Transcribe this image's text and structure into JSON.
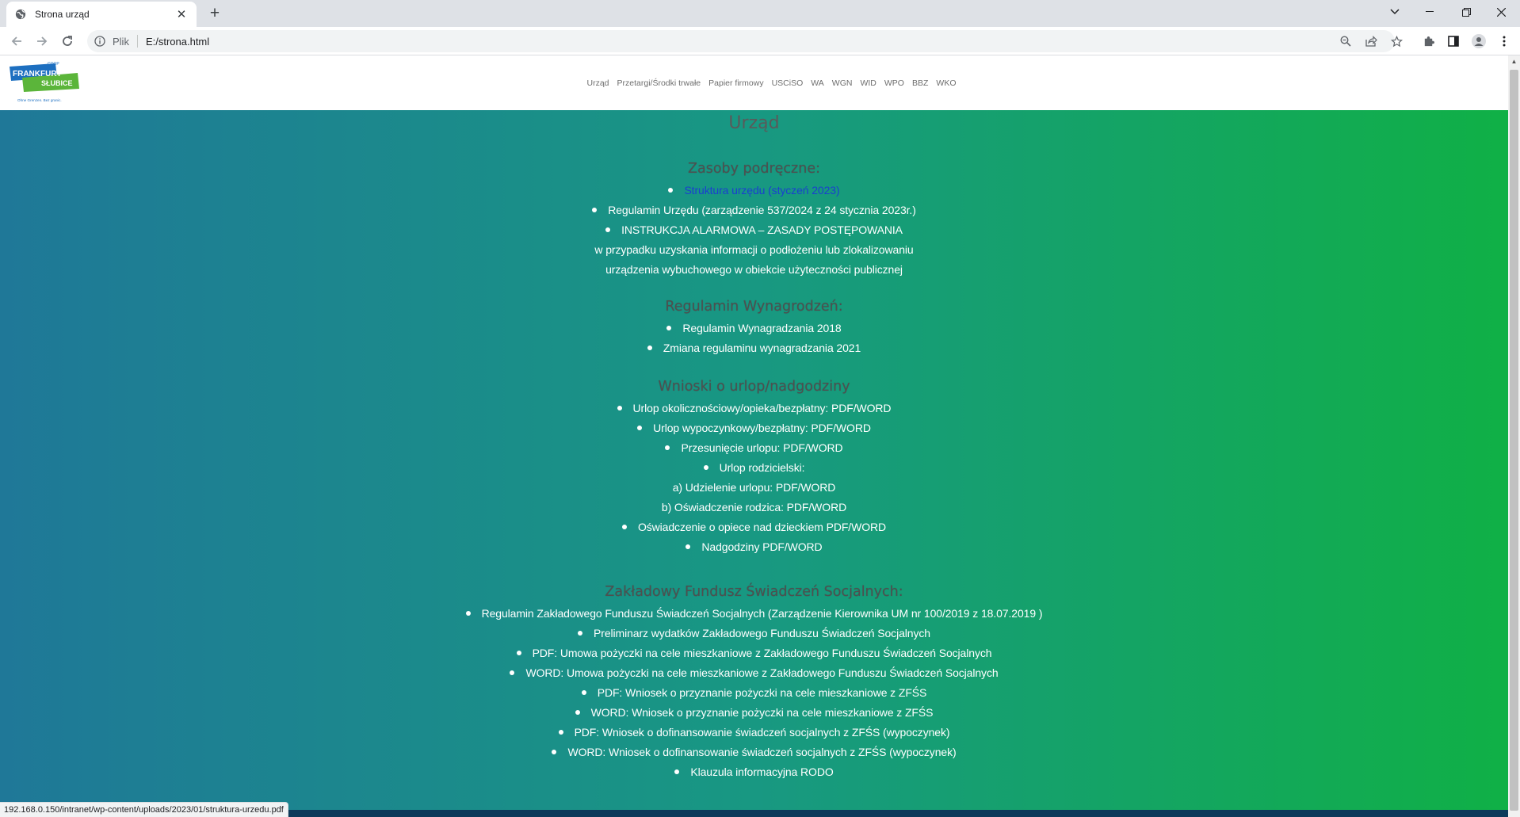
{
  "browser": {
    "tab": {
      "title": "Strona urząd",
      "favicon": "globe-icon"
    },
    "new_tab": "+",
    "address": {
      "scheme": "Plik",
      "url": "E:/strona.html"
    },
    "status_url": "192.168.0.150/intranet/wp-content/uploads/2023/01/struktura-urzedu.pdf"
  },
  "site": {
    "logo": {
      "top_small": "COOP",
      "line1": "FRANKFURT",
      "line2": "SŁUBICE",
      "tagline": "Ohne Grenzen. Bez granic."
    },
    "nav": [
      "Urząd",
      "Przetargi/Środki trwałe",
      "Papier firmowy",
      "USCiSO",
      "WA",
      "WGN",
      "WID",
      "WPO",
      "BBZ",
      "WKO"
    ]
  },
  "page": {
    "heading": "Urząd",
    "sections": {
      "zasoby": {
        "heading": "Zasoby podręczne:",
        "items": [
          "Struktura urzędu (styczeń 2023)",
          "Regulamin Urzędu (zarządzenie 537/2024 z 24 stycznia 2023r.)",
          "INSTRUKCJA ALARMOWA – ZASADY POSTĘPOWANIA",
          "w przypadku uzyskania informacji o podłożeniu lub zlokalizowaniu",
          "urządzenia wybuchowego w obiekcie użyteczności publicznej"
        ]
      },
      "regulamin": {
        "heading": "Regulamin Wynagrodzeń:",
        "items": [
          "Regulamin Wynagradzania 2018",
          "Zmiana regulaminu wynagradzania 2021"
        ]
      },
      "wnioski": {
        "heading": "Wnioski o urlop/nadgodziny",
        "items": [
          "Urlop okolicznościowy/opieka/bezpłatny: PDF/WORD",
          "Urlop wypoczynkowy/bezpłatny: PDF/WORD",
          "Przesunięcie urlopu: PDF/WORD",
          "Urlop rodzicielski:",
          "a) Udzielenie urlopu: PDF/WORD",
          "b) Oświadczenie rodzica: PDF/WORD",
          "Oświadczenie o opiece nad dzieckiem PDF/WORD",
          "Nadgodziny PDF/WORD"
        ]
      },
      "fundusz": {
        "heading": "Zakładowy Fundusz Świadczeń Socjalnych:",
        "items": [
          "Regulamin Zakładowego Funduszu Świadczeń Socjalnych (Zarządzenie Kierownika UM nr 100/2019 z 18.07.2019 )",
          "Preliminarz wydatków Zakładowego Funduszu Świadczeń Socjalnych",
          "PDF: Umowa pożyczki na cele mieszkaniowe z Zakładowego Funduszu Świadczeń Socjalnych",
          "WORD: Umowa pożyczki na cele mieszkaniowe z Zakładowego Funduszu Świadczeń Socjalnych",
          "PDF: Wniosek o przyznanie pożyczki na cele mieszkaniowe z ZFŚS",
          "WORD: Wniosek o przyznanie pożyczki na cele mieszkaniowe z ZFŚS",
          "PDF: Wniosek o dofinansowanie świadczeń socjalnych z ZFŚS (wypoczynek)",
          "WORD: Wniosek o dofinansowanie świadczeń socjalnych z ZFŚS (wypoczynek)",
          "Klauzula informacyjna RODO"
        ]
      }
    }
  },
  "colors": {
    "gradient_left": "#1f7898",
    "gradient_right": "#10b046",
    "link": "#1a3fd0",
    "text": "#ffffff"
  }
}
